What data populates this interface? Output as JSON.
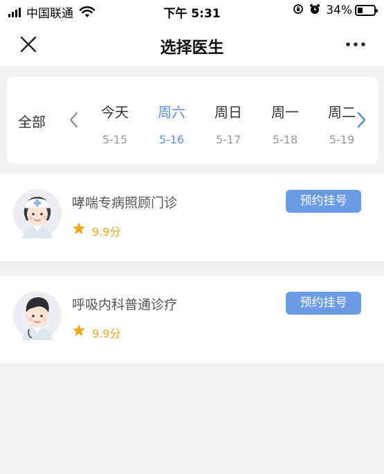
{
  "status_bar": {
    "carrier": "中国联通",
    "time": "下午 5:31",
    "battery_percent_label": "34%",
    "battery_level": 0.34,
    "icons": [
      "signal-icon",
      "wifi-icon",
      "rotation-lock-icon",
      "alarm-icon",
      "battery-icon"
    ]
  },
  "navbar": {
    "title": "选择医生",
    "close_icon": "close-icon",
    "more_icon": "more-icon"
  },
  "date_selector": {
    "all_label": "全部",
    "days": [
      {
        "weekday": "今天",
        "date": "5-15",
        "active": false
      },
      {
        "weekday": "周六",
        "date": "5-16",
        "active": true
      },
      {
        "weekday": "周日",
        "date": "5-17",
        "active": false
      },
      {
        "weekday": "周一",
        "date": "5-18",
        "active": false
      },
      {
        "weekday": "周二",
        "date": "5-19",
        "active": false
      }
    ],
    "accent_color": "#5b8fdd"
  },
  "doctors": [
    {
      "name": "哮喘专病照顾门诊",
      "score": "9.9分",
      "button_label": "预约挂号",
      "avatar": "nurse-avatar"
    },
    {
      "name": "呼吸内科普通诊疗",
      "score": "9.9分",
      "button_label": "预约挂号",
      "avatar": "doctor-avatar"
    }
  ],
  "colors": {
    "button": "#6c9be6",
    "star": "#f5a623",
    "background": "#f2f2f4"
  }
}
